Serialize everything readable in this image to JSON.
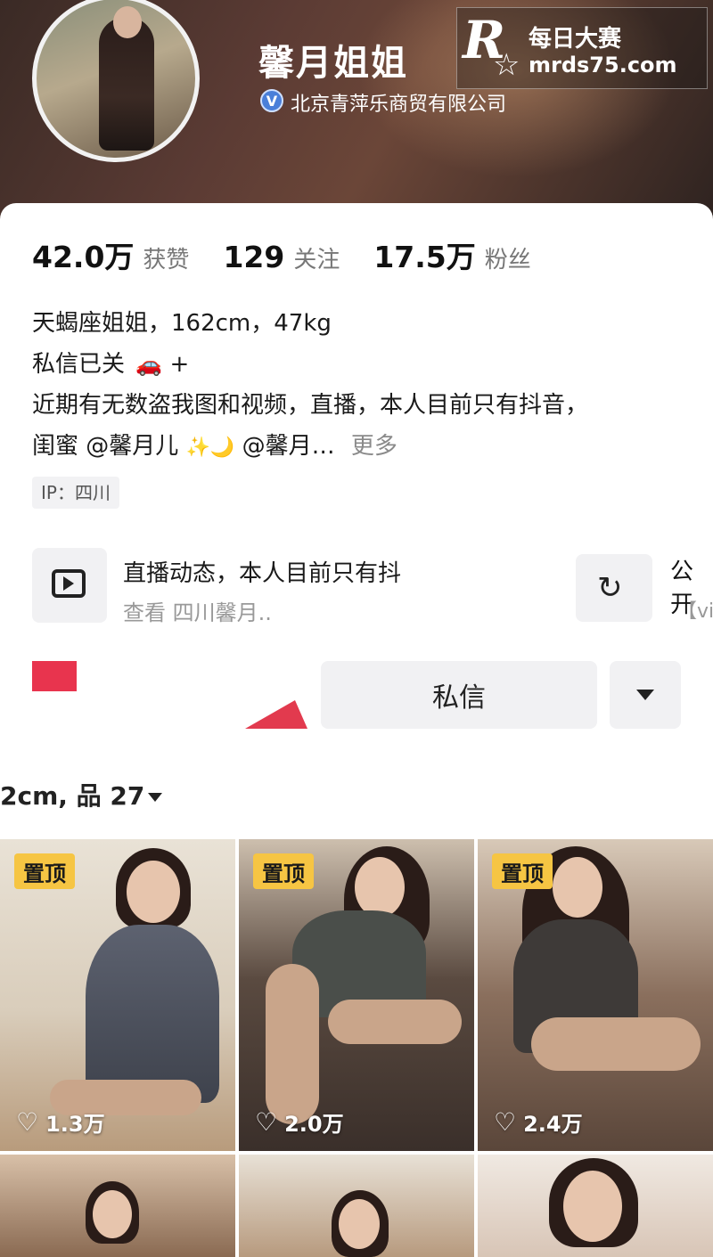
{
  "profile": {
    "name": "馨月姐姐",
    "verified_icon": "V",
    "company": "北京青萍乐商贸有限公司"
  },
  "watermark": {
    "logo": "R",
    "star": "☆",
    "cn": "每日大赛",
    "url": "mrds75.com"
  },
  "stats": [
    {
      "value": "42.0万",
      "label": "获赞"
    },
    {
      "value": "129",
      "label": "关注"
    },
    {
      "value": "17.5万",
      "label": "粉丝"
    }
  ],
  "bio": {
    "line1": "天蝎座姐姐，162cm，47kg",
    "line2": "私信已关",
    "line2_icon": "car-icon",
    "line2_suffix": "+",
    "line3": "近期有无数盗我图和视频，直播，本人目前只有抖音，",
    "line4_a": "闺蜜 @馨月儿",
    "line4_icons": "moon-emoji",
    "line4_b": "@馨月…",
    "more": "更多"
  },
  "ip": "IP：四川",
  "live": {
    "title": "直播动态，本人目前只有抖",
    "sub": "查看 四川馨月.."
  },
  "group": {
    "title": "公开",
    "sub": "【vi"
  },
  "actions": {
    "message": "私信"
  },
  "works": {
    "label": "2cm, 品 27"
  },
  "grid": [
    {
      "pinned": true,
      "pin_label": "置顶",
      "likes": "1.3万"
    },
    {
      "pinned": true,
      "pin_label": "置顶",
      "likes": "2.0万"
    },
    {
      "pinned": true,
      "pin_label": "置顶",
      "likes": "2.4万"
    },
    {
      "pinned": false,
      "pin_label": "",
      "likes": ""
    },
    {
      "pinned": false,
      "pin_label": "",
      "likes": ""
    },
    {
      "pinned": false,
      "pin_label": "",
      "likes": ""
    }
  ],
  "colors": {
    "pin_bg": "#f6c543",
    "follow_red": "#e8344e",
    "verified_blue": "#4a7fd9"
  }
}
